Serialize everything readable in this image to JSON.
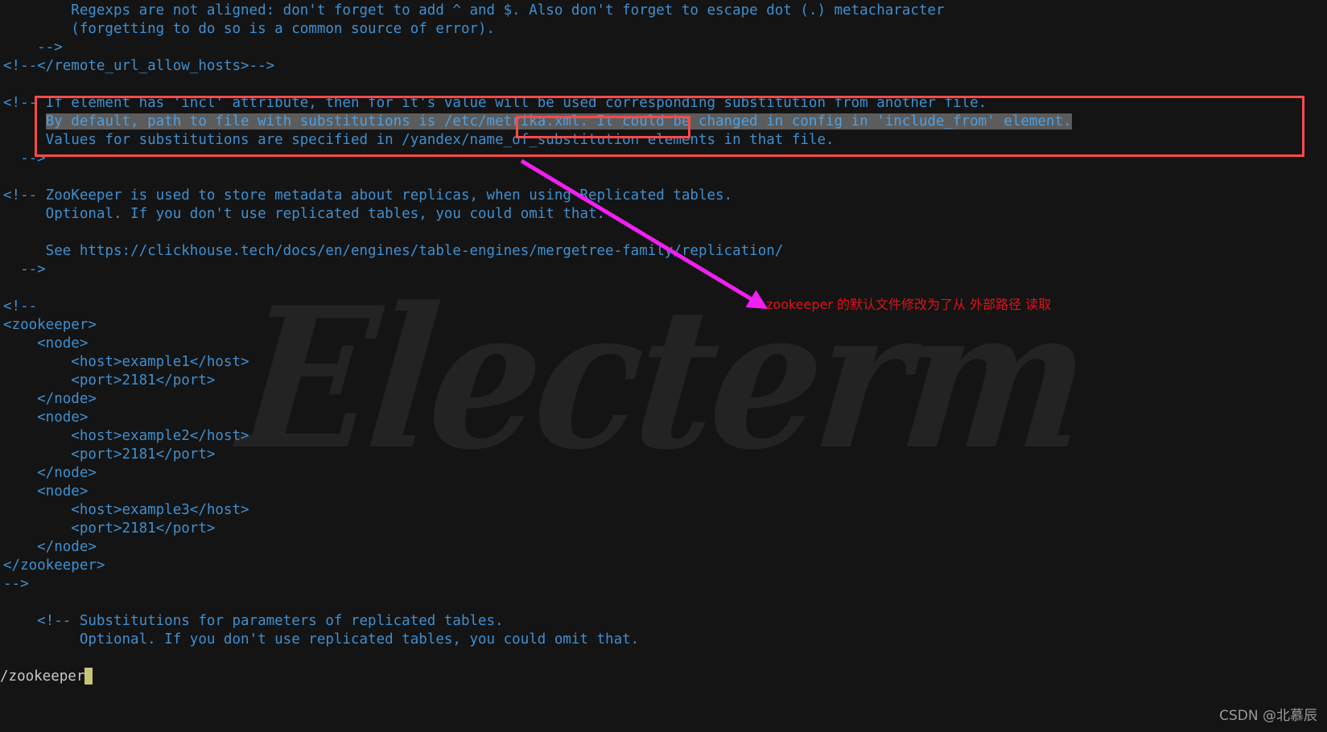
{
  "app": {
    "name": "electerm-terminal",
    "background_color": "#141414",
    "code_color": "#3f8fd0",
    "highlight_bg": "#5c5c5c",
    "annotation_box_color": "#fb4a4a",
    "arrow_color": "#f020f0",
    "annotation_text_color": "#e0121b",
    "cursor_color": "#c8c479"
  },
  "watermark": {
    "text": "Electerm"
  },
  "code": {
    "lines": [
      {
        "segments": [
          {
            "text": "        Regexps are not aligned: don't forget to add ^ and $. Also don't forget to escape dot (.) metacharacter"
          }
        ]
      },
      {
        "segments": [
          {
            "text": "        (forgetting to do so is a common source of error)."
          }
        ]
      },
      {
        "segments": [
          {
            "text": "    -->"
          }
        ]
      },
      {
        "segments": [
          {
            "text": "<!--</remote_url_allow_hosts>-->"
          }
        ]
      },
      {
        "segments": [
          {
            "text": ""
          }
        ]
      },
      {
        "segments": [
          {
            "text": "<!-- If element has 'incl' attribute, then for it's value will be used corresponding substitution from another file."
          }
        ]
      },
      {
        "segments": [
          {
            "text": "     "
          },
          {
            "text": "By default, path to file with substitutions is /etc/metrika.xml. It could be changed in config in 'include_from' element.",
            "highlight": true
          }
        ]
      },
      {
        "segments": [
          {
            "text": "     Values for substitutions are specified in /yandex/name_of_substitution elements in that file."
          }
        ]
      },
      {
        "segments": [
          {
            "text": "  -->"
          }
        ]
      },
      {
        "segments": [
          {
            "text": ""
          }
        ]
      },
      {
        "segments": [
          {
            "text": "<!-- ZooKeeper is used to store metadata about replicas, when using Replicated tables."
          }
        ]
      },
      {
        "segments": [
          {
            "text": "     Optional. If you don't use replicated tables, you could omit that."
          }
        ]
      },
      {
        "segments": [
          {
            "text": ""
          }
        ]
      },
      {
        "segments": [
          {
            "text": "     See https://clickhouse.tech/docs/en/engines/table-engines/mergetree-family/replication/"
          }
        ]
      },
      {
        "segments": [
          {
            "text": "  -->"
          }
        ]
      },
      {
        "segments": [
          {
            "text": ""
          }
        ]
      },
      {
        "segments": [
          {
            "text": "<!--"
          }
        ]
      },
      {
        "segments": [
          {
            "text": "<zookeeper>"
          }
        ]
      },
      {
        "segments": [
          {
            "text": "    <node>"
          }
        ]
      },
      {
        "segments": [
          {
            "text": "        <host>example1</host>"
          }
        ]
      },
      {
        "segments": [
          {
            "text": "        <port>2181</port>"
          }
        ]
      },
      {
        "segments": [
          {
            "text": "    </node>"
          }
        ]
      },
      {
        "segments": [
          {
            "text": "    <node>"
          }
        ]
      },
      {
        "segments": [
          {
            "text": "        <host>example2</host>"
          }
        ]
      },
      {
        "segments": [
          {
            "text": "        <port>2181</port>"
          }
        ]
      },
      {
        "segments": [
          {
            "text": "    </node>"
          }
        ]
      },
      {
        "segments": [
          {
            "text": "    <node>"
          }
        ]
      },
      {
        "segments": [
          {
            "text": "        <host>example3</host>"
          }
        ]
      },
      {
        "segments": [
          {
            "text": "        <port>2181</port>"
          }
        ]
      },
      {
        "segments": [
          {
            "text": "    </node>"
          }
        ]
      },
      {
        "segments": [
          {
            "text": "</zookeeper>"
          }
        ]
      },
      {
        "segments": [
          {
            "text": "-->"
          }
        ]
      },
      {
        "segments": [
          {
            "text": ""
          }
        ]
      },
      {
        "segments": [
          {
            "text": "    <!-- Substitutions for parameters of replicated tables."
          }
        ]
      },
      {
        "segments": [
          {
            "text": "         Optional. If you don't use replicated tables, you could omit that."
          }
        ]
      }
    ]
  },
  "annotations": {
    "chinese_note": "zookeeper 的默认文件修改为了从 外部路径 读取",
    "outer_box_label": "include-from-comment-box",
    "inner_box_label": "metrika-path-box"
  },
  "statusline": {
    "command": "/zookeeper"
  },
  "footer": {
    "csdn_credit": "CSDN @北慕辰"
  }
}
